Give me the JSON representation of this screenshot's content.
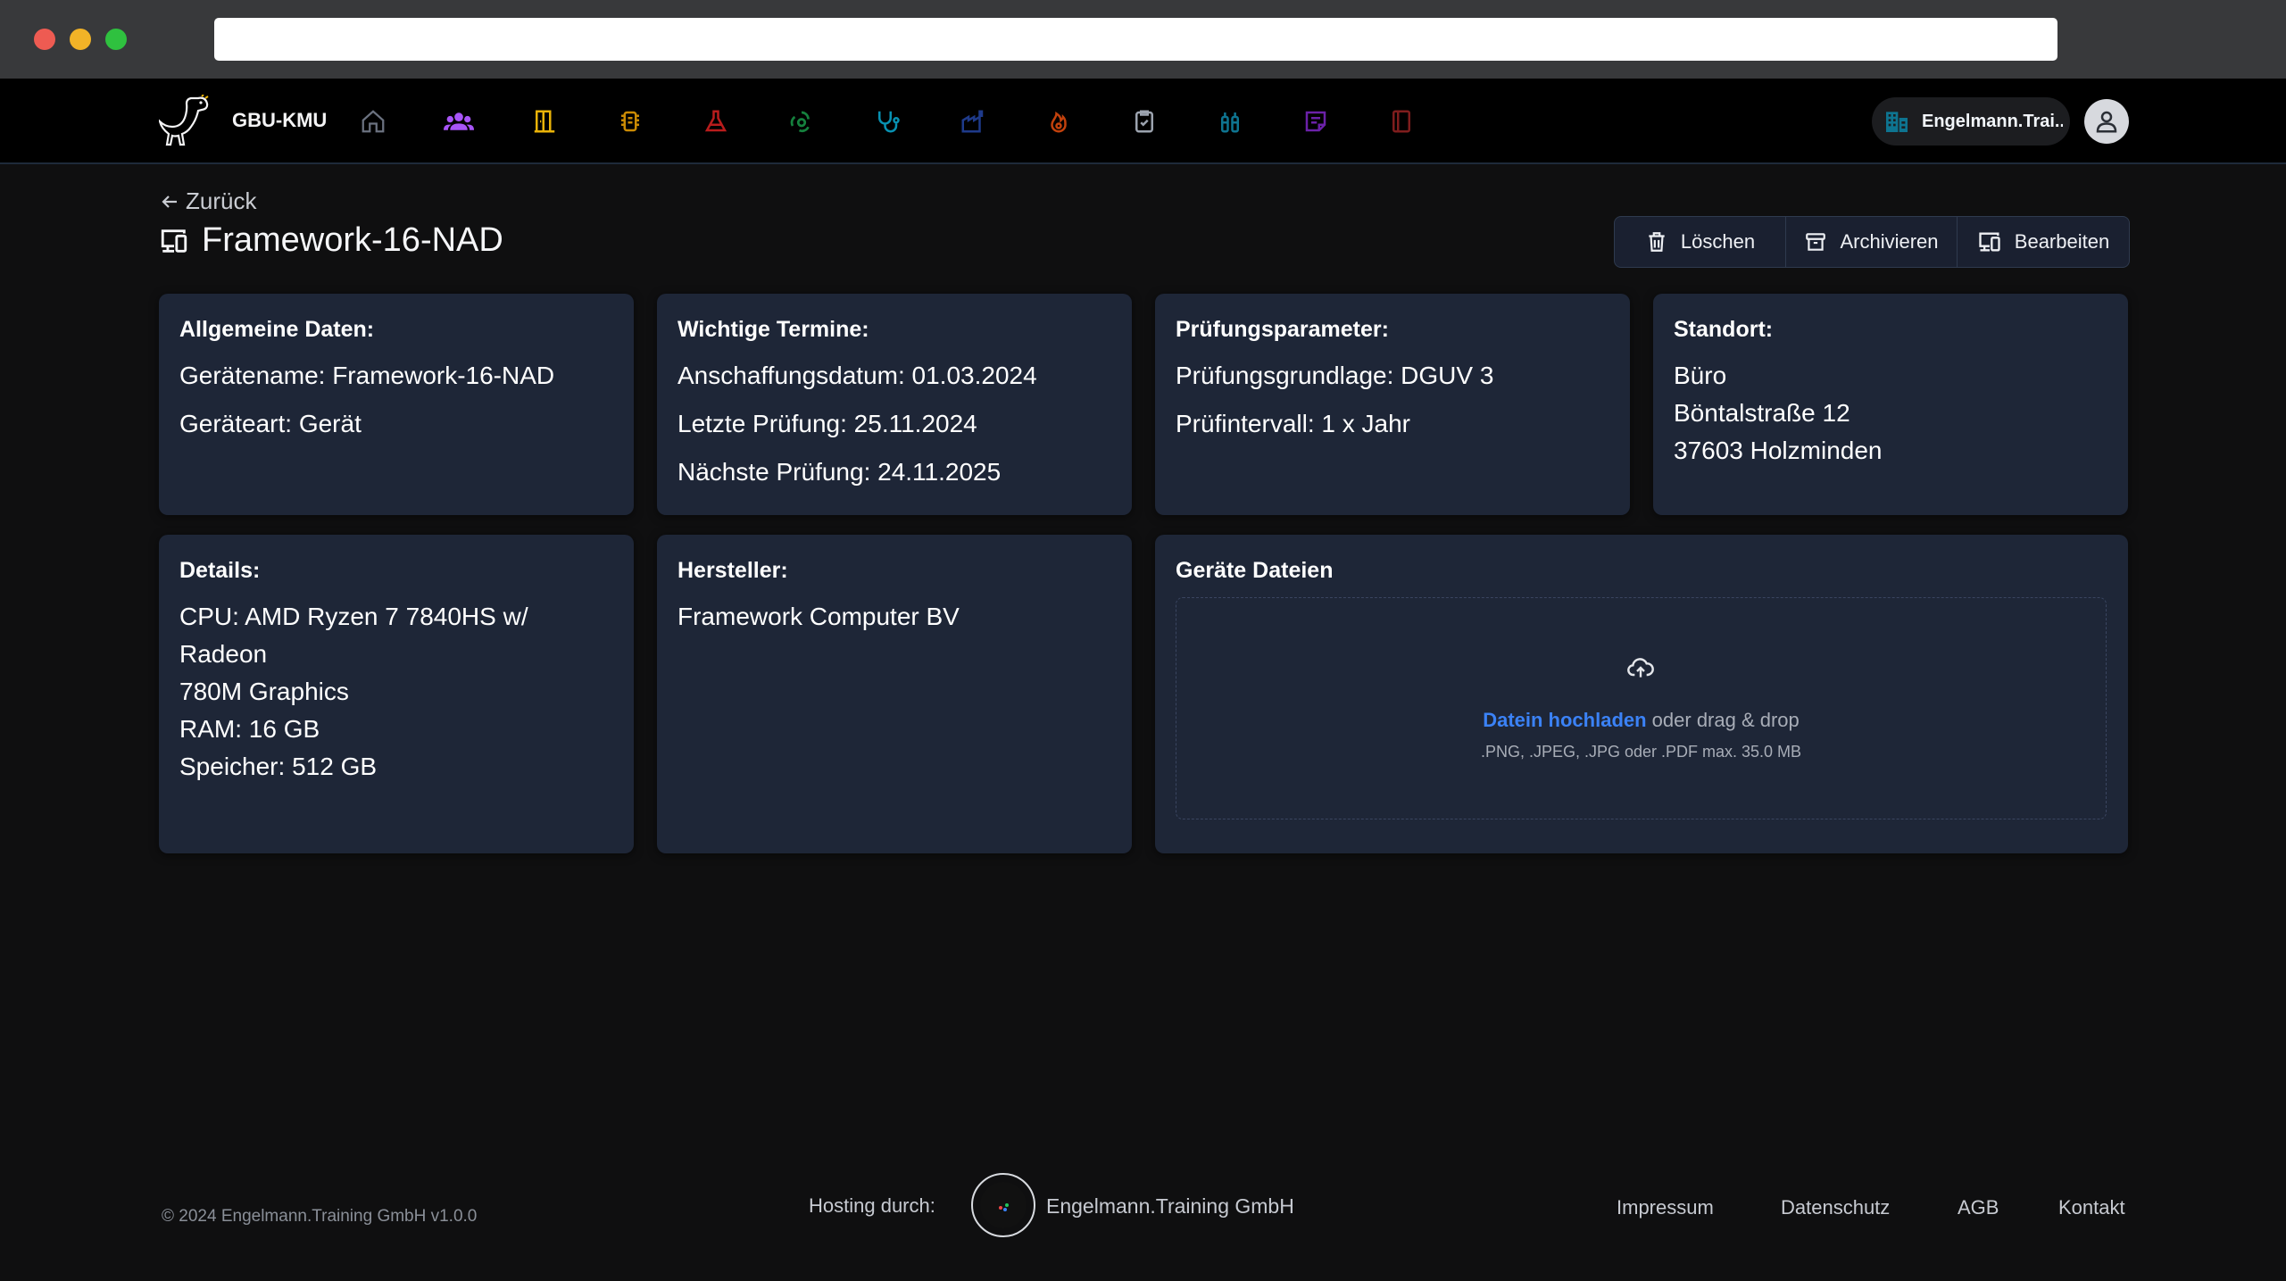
{
  "app": {
    "brand": "GBU-KMU",
    "org_name": "Engelmann.Trai...",
    "nav_icons": [
      {
        "name": "home-icon",
        "color": "#6b7280"
      },
      {
        "name": "users-icon",
        "color": "#a855f7"
      },
      {
        "name": "door-icon",
        "color": "#eab308"
      },
      {
        "name": "chip-icon",
        "color": "#ca8a04"
      },
      {
        "name": "flask-icon",
        "color": "#b91c1c"
      },
      {
        "name": "biohazard-icon",
        "color": "#15803d"
      },
      {
        "name": "stethoscope-icon",
        "color": "#0891b2"
      },
      {
        "name": "machine-icon",
        "color": "#1e3a8a"
      },
      {
        "name": "fire-icon",
        "color": "#c2410c"
      },
      {
        "name": "clipboard-check-icon",
        "color": "#9ca3af"
      },
      {
        "name": "fire-extinguisher-icon",
        "color": "#0e7490"
      },
      {
        "name": "notes-icon",
        "color": "#6b21a8"
      },
      {
        "name": "book-icon",
        "color": "#7f1d1d"
      }
    ]
  },
  "page": {
    "back_label": "Zurück",
    "title": "Framework-16-NAD",
    "actions": {
      "delete": "Löschen",
      "archive": "Archivieren",
      "edit": "Bearbeiten"
    }
  },
  "cards": {
    "general": {
      "heading": "Allgemeine Daten:",
      "device_name": "Gerätename: Framework-16-NAD",
      "device_type": "Geräteart: Gerät"
    },
    "dates": {
      "heading": "Wichtige Termine:",
      "purchase": "Anschaffungsdatum: 01.03.2024",
      "last_check": "Letzte Prüfung: 25.11.2024",
      "next_check": "Nächste Prüfung: 24.11.2025"
    },
    "inspection": {
      "heading": "Prüfungsparameter:",
      "basis": "Prüfungsgrundlage: DGUV 3",
      "interval": "Prüfintervall: 1 x Jahr"
    },
    "location": {
      "heading": "Standort:",
      "line1": "Büro",
      "line2": "Böntalstraße 12",
      "line3": "37603 Holzminden"
    },
    "details": {
      "heading": "Details:",
      "cpu_line1": "CPU: AMD Ryzen 7 7840HS w/ Radeon",
      "cpu_line2": "780M Graphics",
      "ram": "RAM: 16 GB",
      "storage": "Speicher: 512 GB"
    },
    "manufacturer": {
      "heading": "Hersteller:",
      "name": "Framework Computer BV"
    },
    "files": {
      "heading": "Geräte Dateien",
      "upload_link": "Datein hochladen",
      "upload_rest": " oder drag & drop",
      "hint": ".PNG, .JPEG, .JPG oder .PDF max. 35.0 MB"
    }
  },
  "footer": {
    "copyright": "© 2024 Engelmann.Training GmbH v1.0.0",
    "hosting_label": "Hosting durch:",
    "host_name": "Engelmann.Training GmbH",
    "links": [
      "Impressum",
      "Datenschutz",
      "AGB",
      "Kontakt"
    ]
  }
}
